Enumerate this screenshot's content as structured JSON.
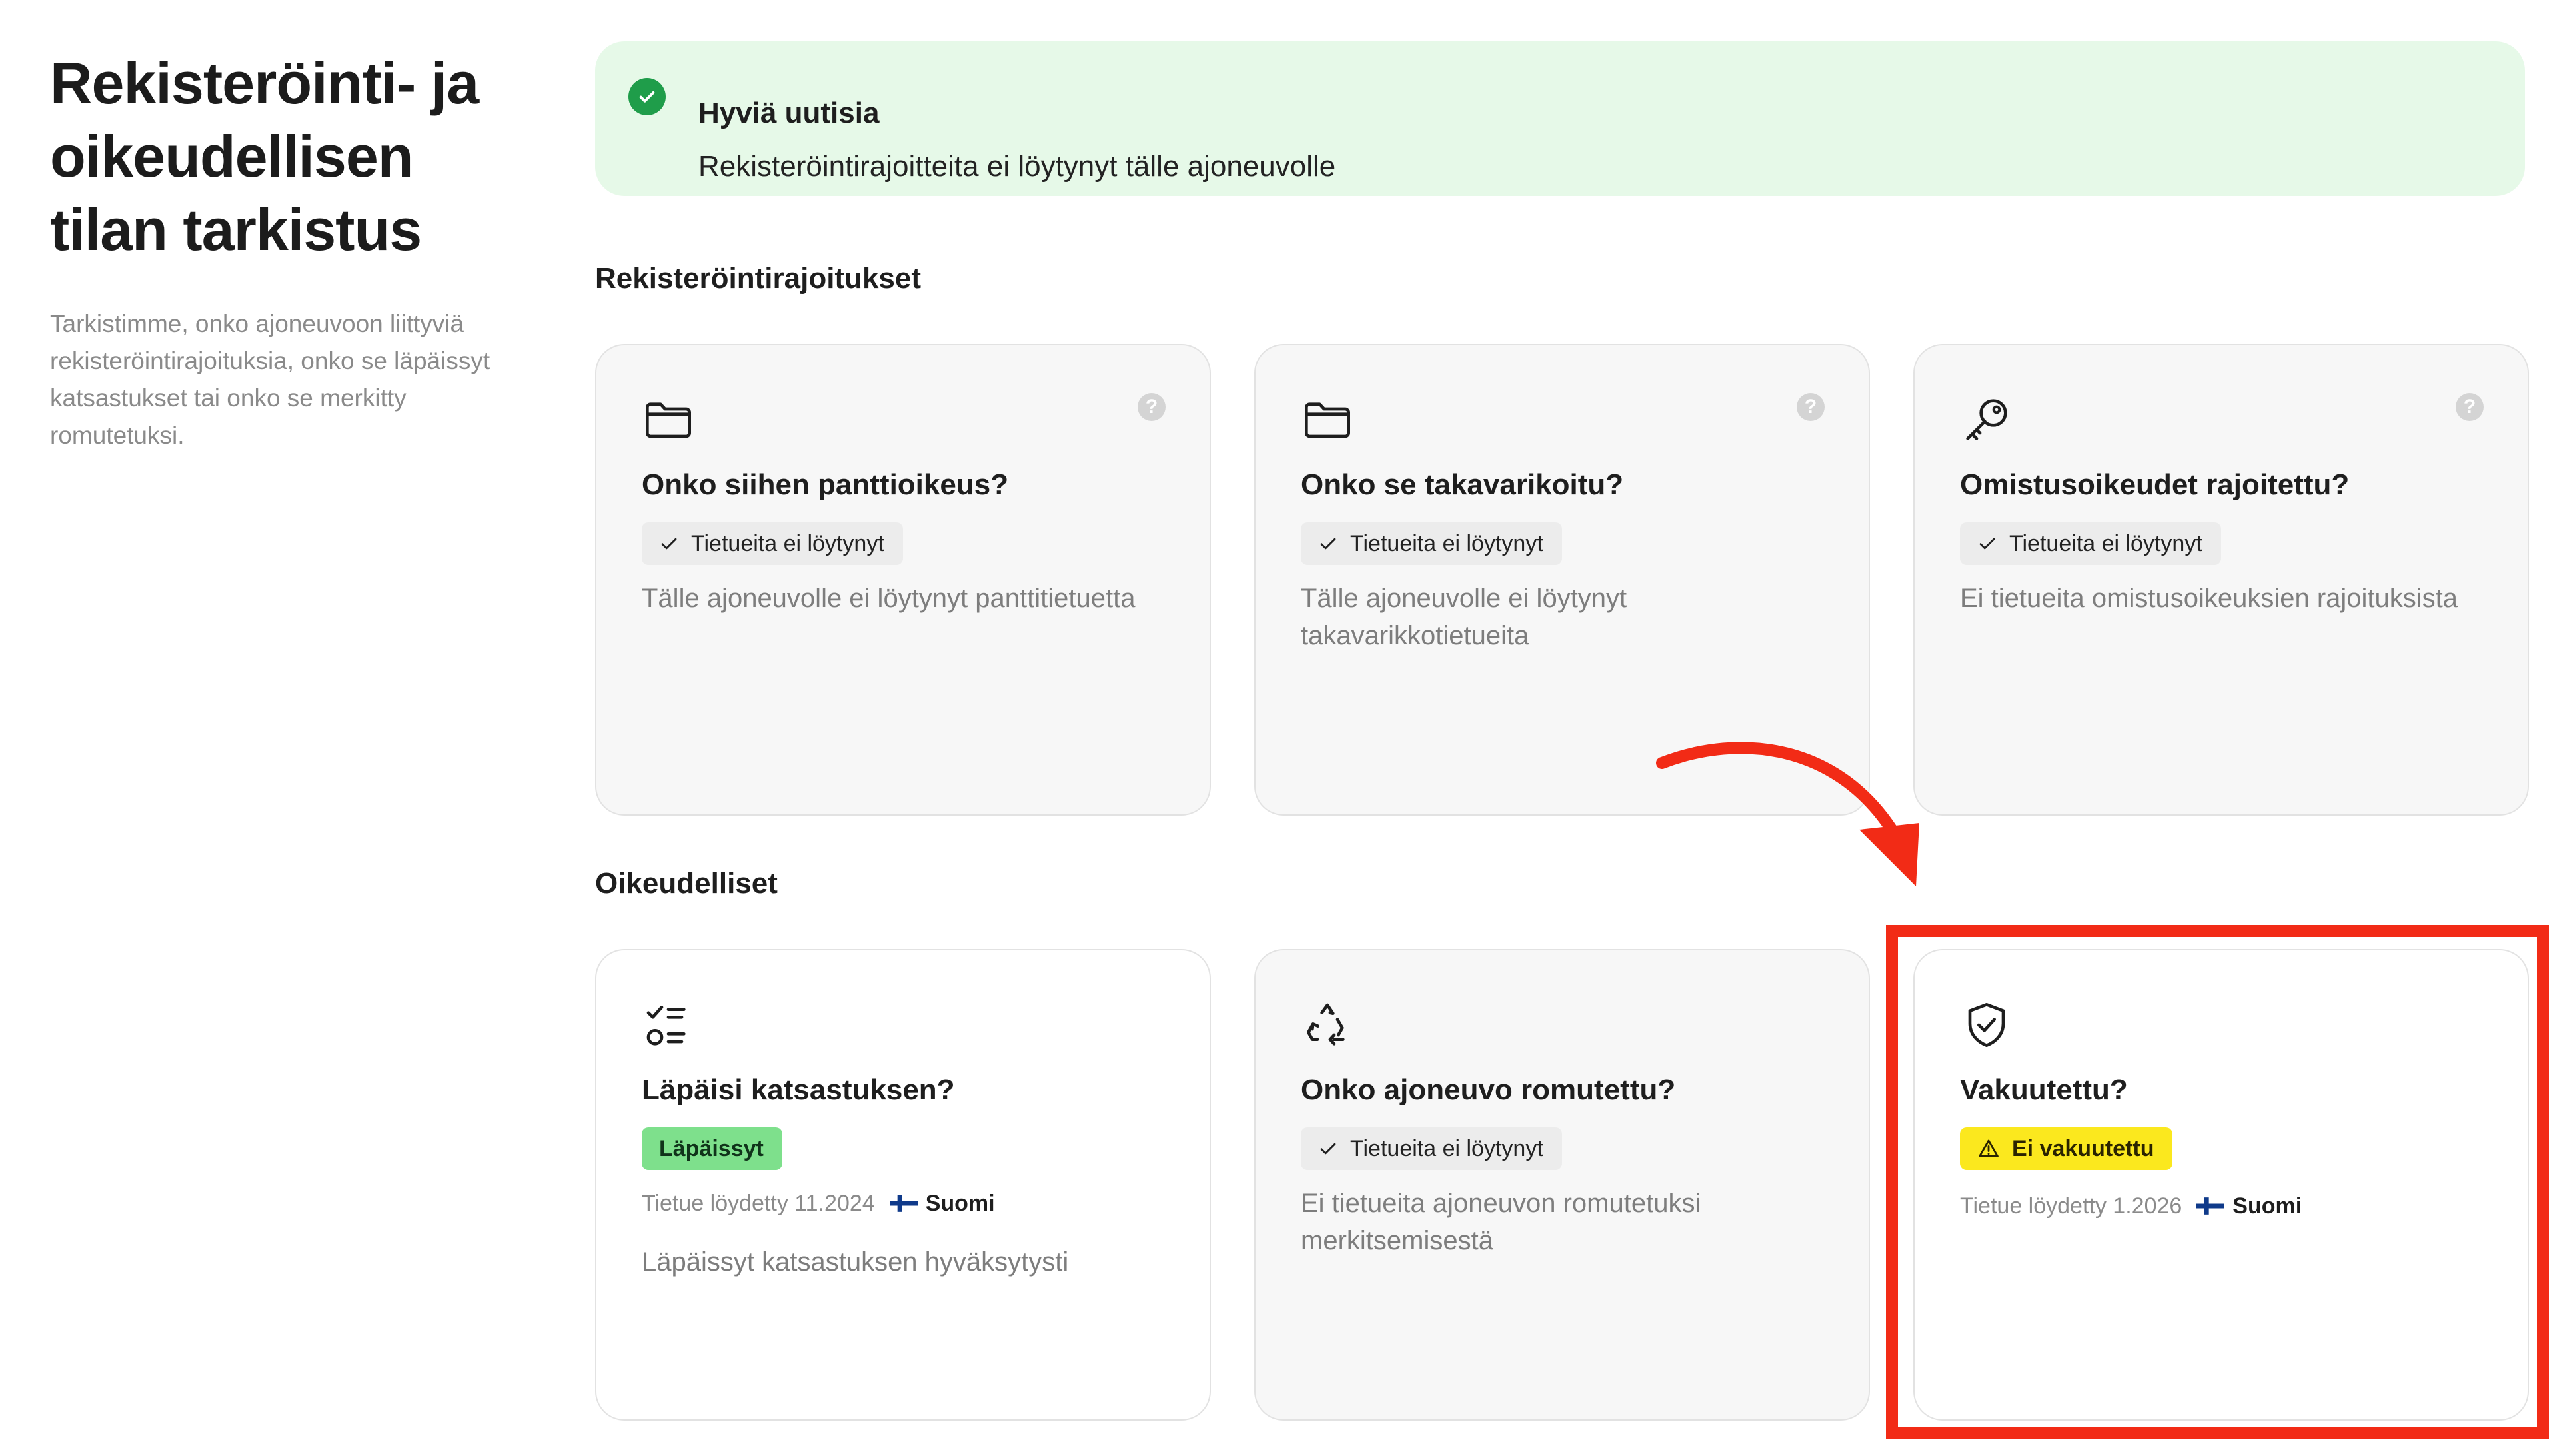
{
  "intro": {
    "title": "Rekisteröinti- ja oikeudellisen tilan tarkistus",
    "description": "Tarkistimme, onko ajoneuvoon liittyviä rekisteröintirajoituksia, onko se läpäissyt katsastukset tai onko se merkitty romutetuksi."
  },
  "banner": {
    "title": "Hyviä uutisia",
    "text": "Rekisteröintirajoitteita ei löytynyt tälle ajoneuvolle",
    "icon": "check-circle-icon",
    "color": "#1f9d4a"
  },
  "sections": {
    "registration": {
      "title": "Rekisteröintirajoitukset",
      "cards": [
        {
          "icon": "folder-icon",
          "title": "Onko siihen panttioikeus?",
          "chip": "Tietueita ei löytynyt",
          "description": "Tälle ajoneuvolle ei löytynyt panttitietuetta"
        },
        {
          "icon": "folder-icon",
          "title": "Onko se takavarikoitu?",
          "chip": "Tietueita ei löytynyt",
          "description": "Tälle ajoneuvolle ei löytynyt takavarikkotietueita"
        },
        {
          "icon": "key-icon",
          "title": "Omistusoikeudet rajoitettu?",
          "chip": "Tietueita ei löytynyt",
          "description": "Ei tietueita omistusoikeuksien rajoituksista"
        }
      ]
    },
    "legal": {
      "title": "Oikeudelliset",
      "cards": [
        {
          "icon": "checklist-icon",
          "title": "Läpäisi katsastuksen?",
          "chip": "Läpäissyt",
          "found": "Tietue löydetty 11.2024",
          "country": "Suomi",
          "description": "Läpäissyt katsastuksen hyväksytysti"
        },
        {
          "icon": "recycle-icon",
          "title": "Onko ajoneuvo romutettu?",
          "chip": "Tietueita ei löytynyt",
          "description": "Ei tietueita ajoneuvon romutetuksi merkitsemisestä"
        },
        {
          "icon": "shield-check-icon",
          "title": "Vakuutettu?",
          "chip": "Ei vakuutettu",
          "found": "Tietue löydetty 1.2026",
          "country": "Suomi"
        }
      ]
    }
  },
  "help_symbol": "?",
  "colors": {
    "success_chip": "#7ee08c",
    "warning_chip": "#fbe81e",
    "annotation": "#f22b16",
    "finland_flag_blue": "#0f3a8a"
  }
}
